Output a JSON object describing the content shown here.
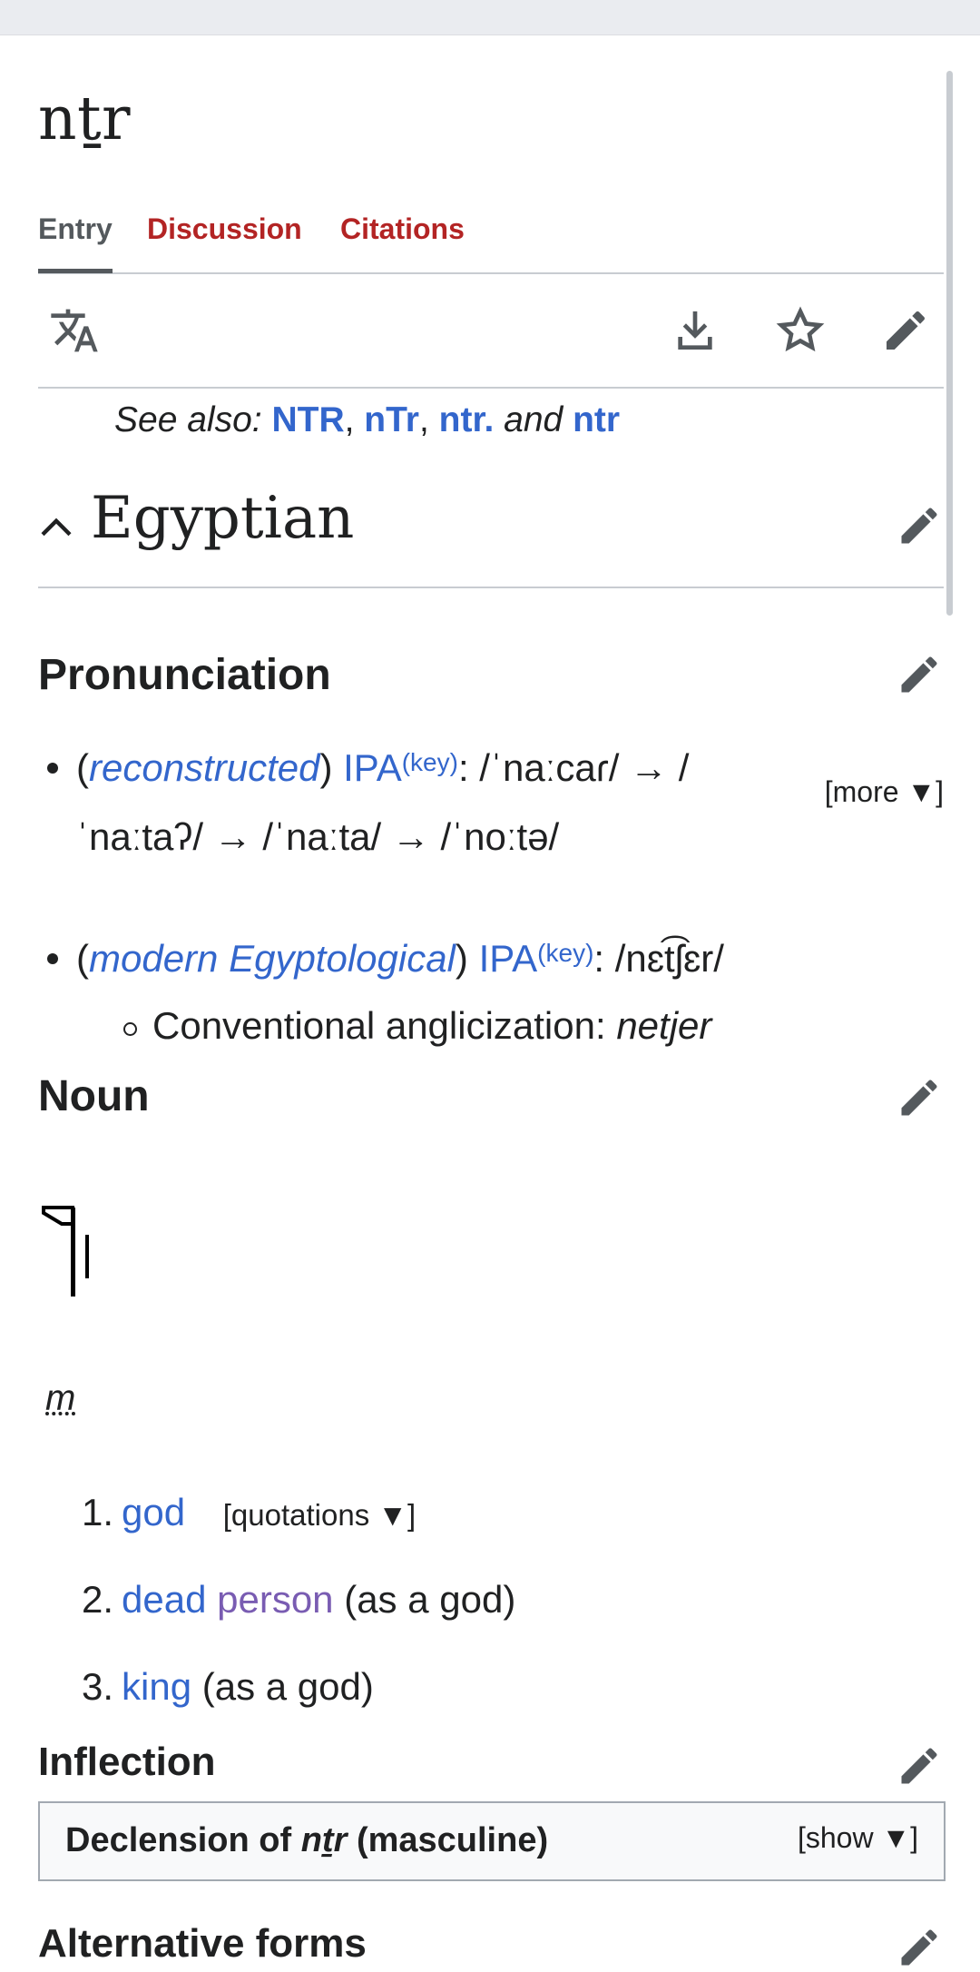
{
  "page": {
    "title": "nṯr"
  },
  "tabs": [
    "Entry",
    "Discussion",
    "Citations"
  ],
  "toolbar": {
    "icons": [
      "translate-icon",
      "download-icon",
      "star-icon",
      "edit-icon"
    ]
  },
  "see_also": {
    "label": "See also:",
    "links": [
      "NTR",
      "nTr",
      "ntr.",
      "ntr"
    ],
    "sep1": ",",
    "sep2": ",",
    "and": "and"
  },
  "language": {
    "name": "Egyptian"
  },
  "pronunciation": {
    "heading": "Pronunciation",
    "more_label": "[more ▼]",
    "item1": {
      "open": "(",
      "qualifier": "reconstructed",
      "close": ")",
      "ipa": "IPA",
      "key": "(key)",
      "line1": ": /ˈnaːcaɾ/ → /",
      "line2": "ˈnaːtaʔ/ → /ˈnaːta/ → /ˈnoːtə/"
    },
    "item2": {
      "open": "(",
      "qualifier": "modern Egyptological",
      "close": ")",
      "ipa": "IPA",
      "key": "(key)",
      "value": ": /nɛt͡ʃɛr/"
    },
    "sub": {
      "label": "Conventional anglicization:",
      "value": "netjer"
    }
  },
  "noun": {
    "heading": "Noun",
    "gender": "m",
    "senses": [
      {
        "num": "1.",
        "link": "god",
        "quotations": "[quotations ▼]"
      },
      {
        "num": "2.",
        "link1": "dead",
        "link2": "person",
        "rest": "(as a god)"
      },
      {
        "num": "3.",
        "link": "king",
        "rest": "(as a god)"
      }
    ]
  },
  "inflection": {
    "heading": "Inflection",
    "table_prefix": "Declension of",
    "table_word": "nṯr",
    "table_suffix": "(masculine)",
    "show_label": "[show ▼]"
  },
  "next_heading": "Alternative forms",
  "colors": {
    "link": "#3366cc",
    "visited": "#795cb2",
    "tab_red": "#b32424",
    "border": "#c8ccd1"
  }
}
